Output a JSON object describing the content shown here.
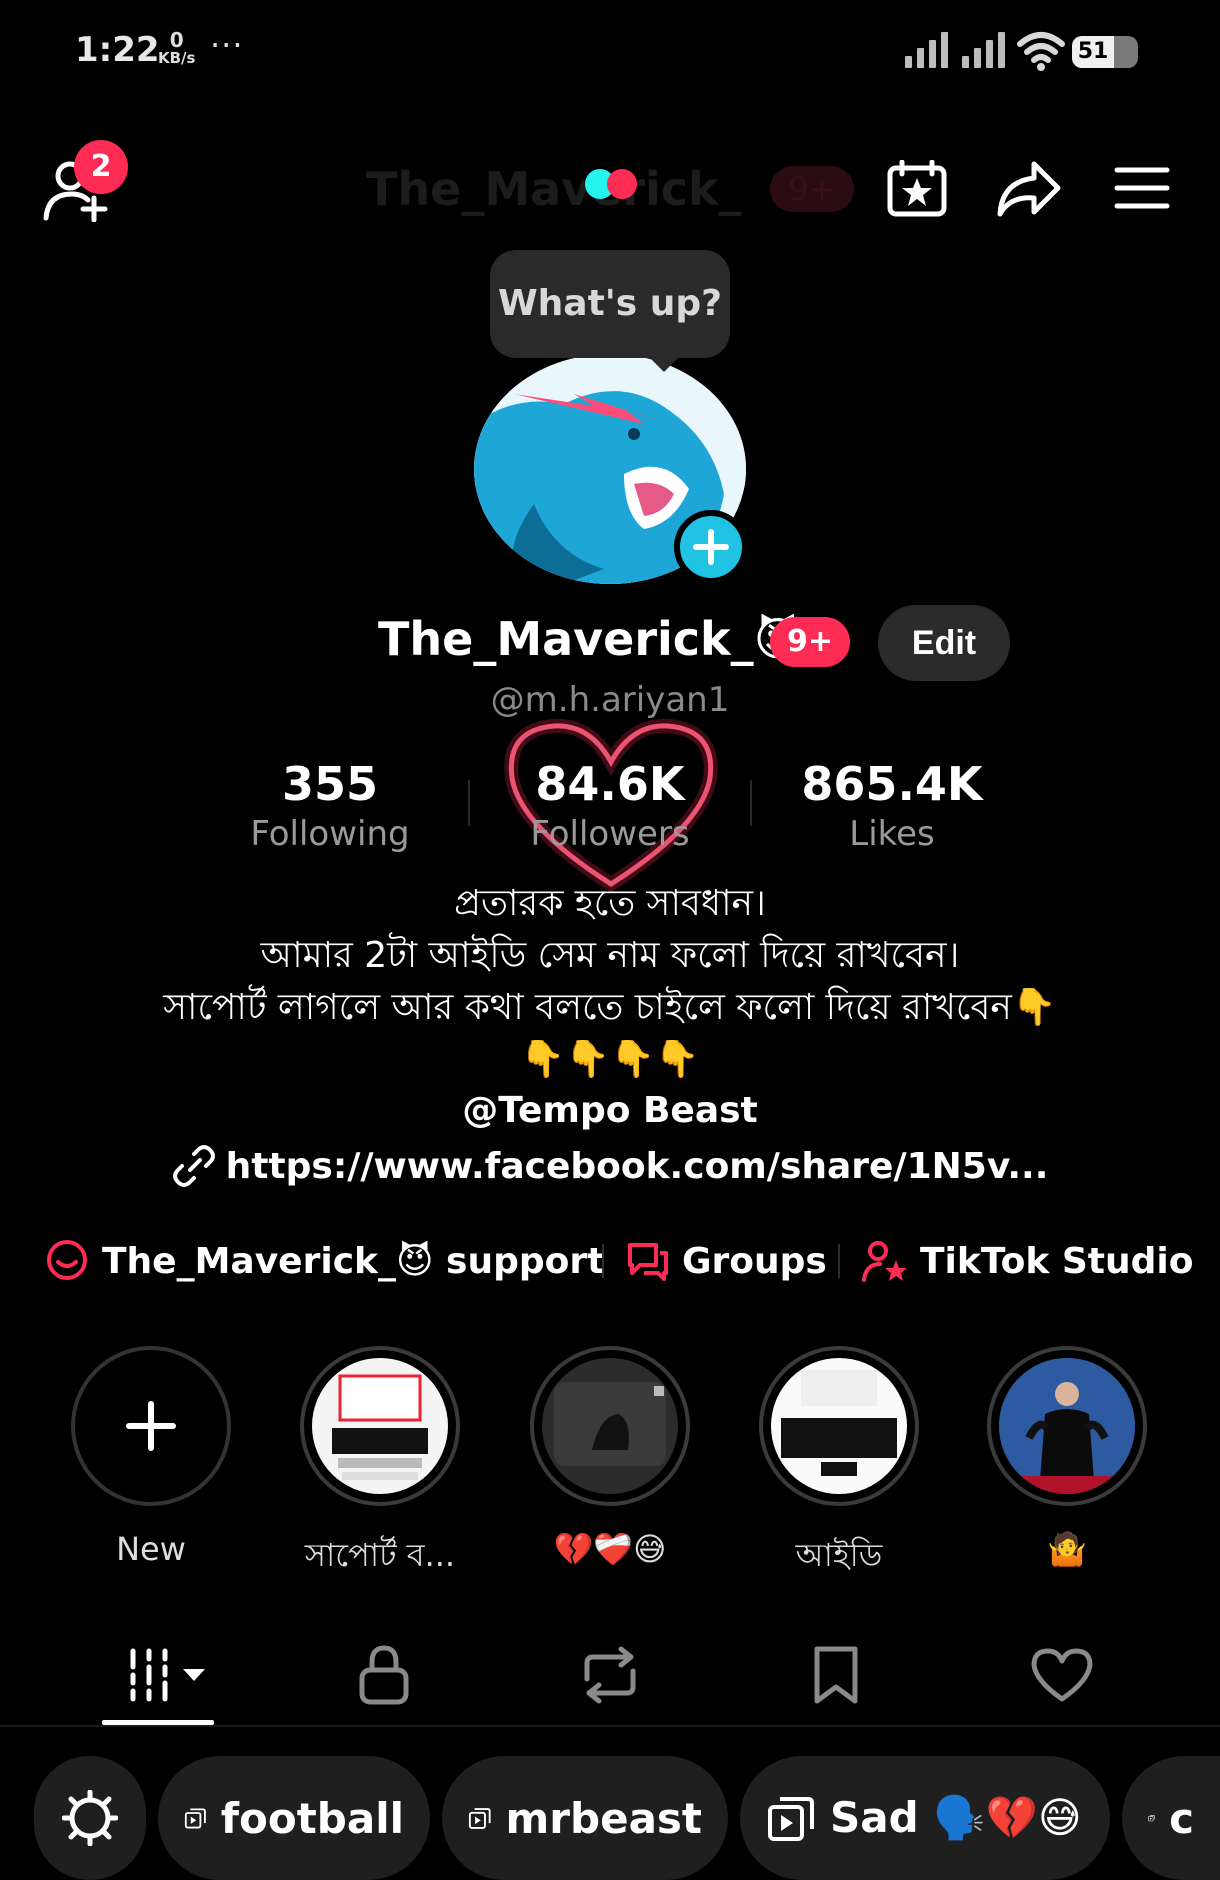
{
  "status_bar": {
    "time": "1:22",
    "net_speed_value": "0",
    "net_speed_unit": "KB/s",
    "more": "···",
    "battery": "51"
  },
  "header": {
    "friend_requests_count": "2",
    "ghost_title": "The_Maverick_",
    "ghost_badge": "9+"
  },
  "profile": {
    "tooltip": "What's up?",
    "display_name": "The_Maverick_😈",
    "badge": "9+",
    "edit_label": "Edit",
    "handle": "@m.h.ariyan1"
  },
  "stats": [
    {
      "value": "355",
      "label": "Following"
    },
    {
      "value": "84.6K",
      "label": "Followers"
    },
    {
      "value": "865.4K",
      "label": "Likes"
    }
  ],
  "bio": {
    "line1": "প্রতারক হতে সাবধান।",
    "line2": "আমার 2টা আইডি সেম নাম ফলো দিয়ে রাখবেন।",
    "line3": "সাপোর্ট লাগলে আর কথা বলতে চাইলে ফলো দিয়ে রাখবেন👇",
    "line4": "👇👇👇👇",
    "mention": "@Tempo Beast",
    "link": "https://www.facebook.com/share/1N5v..."
  },
  "quick_links": [
    {
      "label": "The_Maverick_😈 support",
      "icon": "chat-bubble-icon"
    },
    {
      "label": "Groups",
      "icon": "group-chat-icon"
    },
    {
      "label": "TikTok Studio",
      "icon": "creator-star-icon"
    }
  ],
  "highlights": [
    {
      "label": "New"
    },
    {
      "label": "সাপোর্ট ব..."
    },
    {
      "label": "💔❤️‍🩹😅"
    },
    {
      "label": "আইডি"
    },
    {
      "label": "🤷"
    }
  ],
  "tabs": [
    "videos-grid",
    "private-lock",
    "reposts",
    "favorites",
    "liked"
  ],
  "collections": [
    {
      "label": "football"
    },
    {
      "label": "mrbeast"
    },
    {
      "label": "Sad 🗣️💔😅"
    },
    {
      "label": "c"
    }
  ],
  "colors": {
    "accent_red": "#fe2c55",
    "accent_cyan": "#20c3e4",
    "background": "#000000"
  }
}
